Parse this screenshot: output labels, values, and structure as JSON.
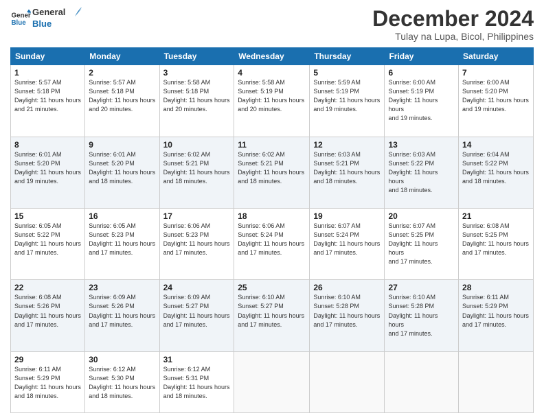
{
  "logo": {
    "line1": "General",
    "line2": "Blue"
  },
  "title": "December 2024",
  "subtitle": "Tulay na Lupa, Bicol, Philippines",
  "weekdays": [
    "Sunday",
    "Monday",
    "Tuesday",
    "Wednesday",
    "Thursday",
    "Friday",
    "Saturday"
  ],
  "weeks": [
    [
      {
        "day": "1",
        "sunrise": "5:57 AM",
        "sunset": "5:18 PM",
        "daylight": "11 hours and 21 minutes."
      },
      {
        "day": "2",
        "sunrise": "5:57 AM",
        "sunset": "5:18 PM",
        "daylight": "11 hours and 20 minutes."
      },
      {
        "day": "3",
        "sunrise": "5:58 AM",
        "sunset": "5:18 PM",
        "daylight": "11 hours and 20 minutes."
      },
      {
        "day": "4",
        "sunrise": "5:58 AM",
        "sunset": "5:19 PM",
        "daylight": "11 hours and 20 minutes."
      },
      {
        "day": "5",
        "sunrise": "5:59 AM",
        "sunset": "5:19 PM",
        "daylight": "11 hours and 19 minutes."
      },
      {
        "day": "6",
        "sunrise": "6:00 AM",
        "sunset": "5:19 PM",
        "daylight": "11 hours and 19 minutes."
      },
      {
        "day": "7",
        "sunrise": "6:00 AM",
        "sunset": "5:20 PM",
        "daylight": "11 hours and 19 minutes."
      }
    ],
    [
      {
        "day": "8",
        "sunrise": "6:01 AM",
        "sunset": "5:20 PM",
        "daylight": "11 hours and 19 minutes."
      },
      {
        "day": "9",
        "sunrise": "6:01 AM",
        "sunset": "5:20 PM",
        "daylight": "11 hours and 18 minutes."
      },
      {
        "day": "10",
        "sunrise": "6:02 AM",
        "sunset": "5:21 PM",
        "daylight": "11 hours and 18 minutes."
      },
      {
        "day": "11",
        "sunrise": "6:02 AM",
        "sunset": "5:21 PM",
        "daylight": "11 hours and 18 minutes."
      },
      {
        "day": "12",
        "sunrise": "6:03 AM",
        "sunset": "5:21 PM",
        "daylight": "11 hours and 18 minutes."
      },
      {
        "day": "13",
        "sunrise": "6:03 AM",
        "sunset": "5:22 PM",
        "daylight": "11 hours and 18 minutes."
      },
      {
        "day": "14",
        "sunrise": "6:04 AM",
        "sunset": "5:22 PM",
        "daylight": "11 hours and 18 minutes."
      }
    ],
    [
      {
        "day": "15",
        "sunrise": "6:05 AM",
        "sunset": "5:22 PM",
        "daylight": "11 hours and 17 minutes."
      },
      {
        "day": "16",
        "sunrise": "6:05 AM",
        "sunset": "5:23 PM",
        "daylight": "11 hours and 17 minutes."
      },
      {
        "day": "17",
        "sunrise": "6:06 AM",
        "sunset": "5:23 PM",
        "daylight": "11 hours and 17 minutes."
      },
      {
        "day": "18",
        "sunrise": "6:06 AM",
        "sunset": "5:24 PM",
        "daylight": "11 hours and 17 minutes."
      },
      {
        "day": "19",
        "sunrise": "6:07 AM",
        "sunset": "5:24 PM",
        "daylight": "11 hours and 17 minutes."
      },
      {
        "day": "20",
        "sunrise": "6:07 AM",
        "sunset": "5:25 PM",
        "daylight": "11 hours and 17 minutes."
      },
      {
        "day": "21",
        "sunrise": "6:08 AM",
        "sunset": "5:25 PM",
        "daylight": "11 hours and 17 minutes."
      }
    ],
    [
      {
        "day": "22",
        "sunrise": "6:08 AM",
        "sunset": "5:26 PM",
        "daylight": "11 hours and 17 minutes."
      },
      {
        "day": "23",
        "sunrise": "6:09 AM",
        "sunset": "5:26 PM",
        "daylight": "11 hours and 17 minutes."
      },
      {
        "day": "24",
        "sunrise": "6:09 AM",
        "sunset": "5:27 PM",
        "daylight": "11 hours and 17 minutes."
      },
      {
        "day": "25",
        "sunrise": "6:10 AM",
        "sunset": "5:27 PM",
        "daylight": "11 hours and 17 minutes."
      },
      {
        "day": "26",
        "sunrise": "6:10 AM",
        "sunset": "5:28 PM",
        "daylight": "11 hours and 17 minutes."
      },
      {
        "day": "27",
        "sunrise": "6:10 AM",
        "sunset": "5:28 PM",
        "daylight": "11 hours and 17 minutes."
      },
      {
        "day": "28",
        "sunrise": "6:11 AM",
        "sunset": "5:29 PM",
        "daylight": "11 hours and 17 minutes."
      }
    ],
    [
      {
        "day": "29",
        "sunrise": "6:11 AM",
        "sunset": "5:29 PM",
        "daylight": "11 hours and 18 minutes."
      },
      {
        "day": "30",
        "sunrise": "6:12 AM",
        "sunset": "5:30 PM",
        "daylight": "11 hours and 18 minutes."
      },
      {
        "day": "31",
        "sunrise": "6:12 AM",
        "sunset": "5:31 PM",
        "daylight": "11 hours and 18 minutes."
      },
      null,
      null,
      null,
      null
    ]
  ]
}
